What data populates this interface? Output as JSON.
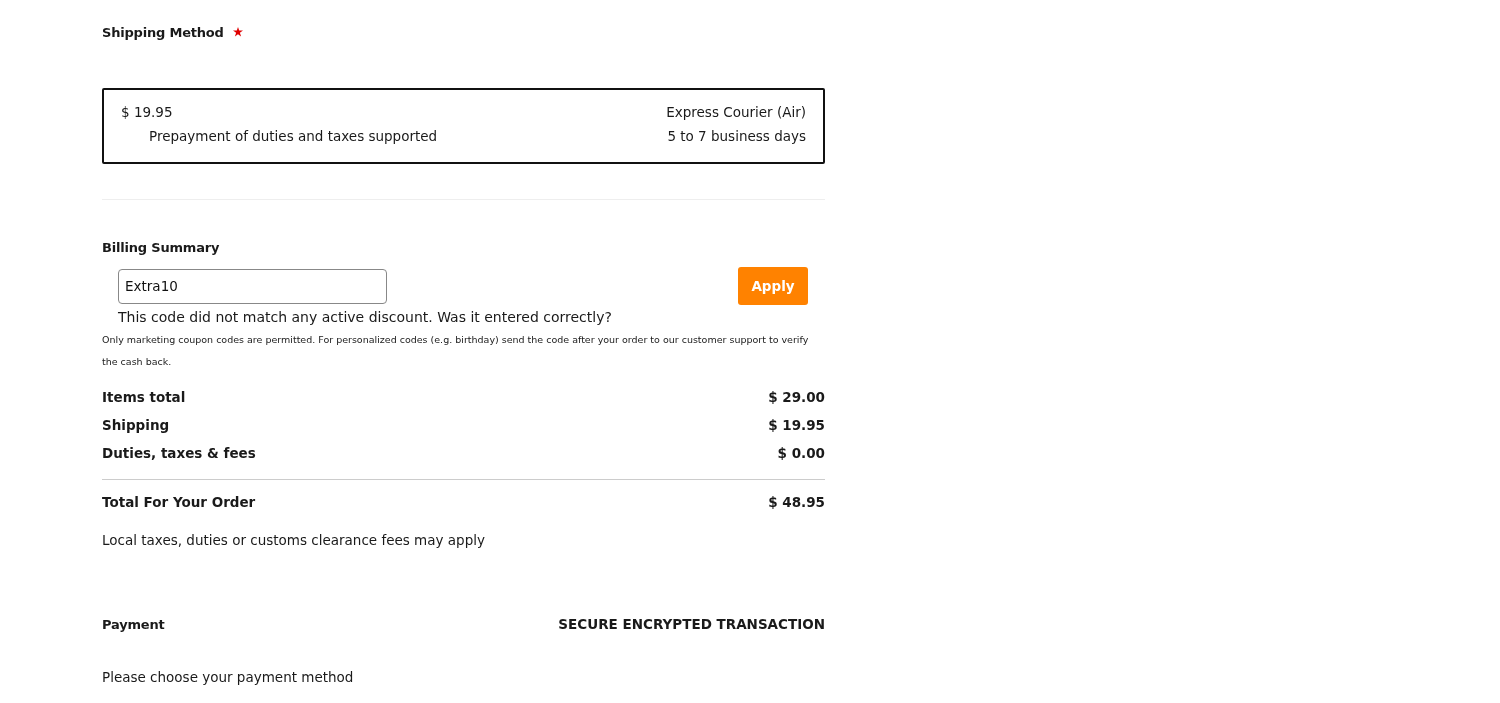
{
  "shipping": {
    "title": "Shipping Method",
    "required": true,
    "options": [
      {
        "price": "$ 19.95",
        "note": "Prepayment of duties and taxes supported",
        "carrier": "Express Courier (Air)",
        "duration": "5 to 7 business days",
        "selected": true
      }
    ]
  },
  "billing": {
    "title": "Billing Summary",
    "coupon": {
      "value": "Extra10",
      "button": "Apply",
      "error": "This code did not match any active discount. Was it entered correctly?"
    },
    "note": "Only marketing coupon codes are permitted. For personalized codes (e.g. birthday) send the code after your order to our customer support to verify the cash back.",
    "lines": [
      {
        "label": "Items total",
        "amount": "$ 29.00"
      },
      {
        "label": "Shipping",
        "amount": "$ 19.95"
      },
      {
        "label": "Duties, taxes & fees",
        "amount": "$ 0.00"
      }
    ],
    "total": {
      "label": "Total For Your Order",
      "amount": "$ 48.95"
    },
    "disclaimer": "Local taxes, duties or customs clearance fees may apply"
  },
  "payment": {
    "title": "Payment",
    "secure_label": "SECURE ENCRYPTED TRANSACTION",
    "prompt": "Please choose your payment method"
  }
}
